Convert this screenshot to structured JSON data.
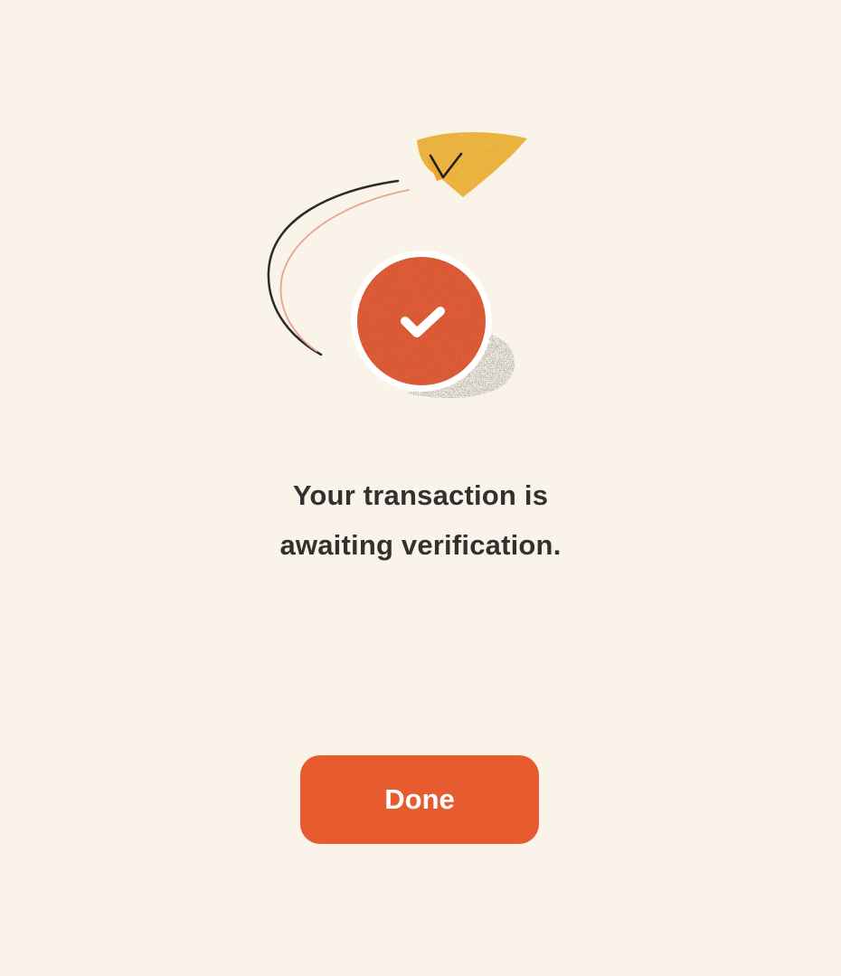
{
  "illustration": {
    "icon": "check-icon",
    "accent_color": "#E6603A",
    "plane_color": "#F7BD45"
  },
  "message": {
    "line1": "Your transaction is",
    "line2": "awaiting verification."
  },
  "actions": {
    "done_label": "Done",
    "button_color": "#E65C2E"
  }
}
